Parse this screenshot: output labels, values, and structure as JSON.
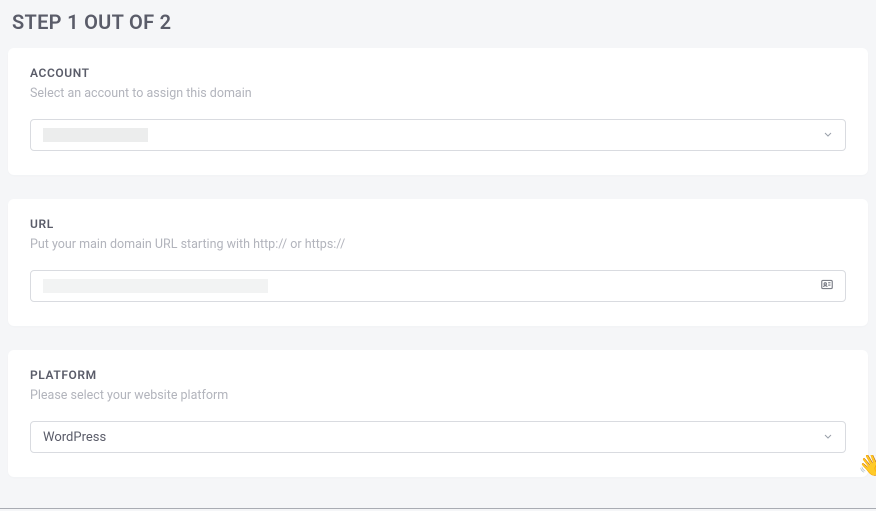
{
  "stepTitle": "STEP 1 OUT OF 2",
  "account": {
    "label": "ACCOUNT",
    "description": "Select an account to assign this domain",
    "selected": ""
  },
  "url": {
    "label": "URL",
    "description": "Put your main domain URL starting with http:// or https://",
    "value": ""
  },
  "platform": {
    "label": "PLATFORM",
    "description": "Please select your website platform",
    "selected": "WordPress"
  },
  "icons": {
    "chevronDown": "chevron-down-icon",
    "contactCard": "contact-card-icon",
    "wave": "wave-icon"
  }
}
